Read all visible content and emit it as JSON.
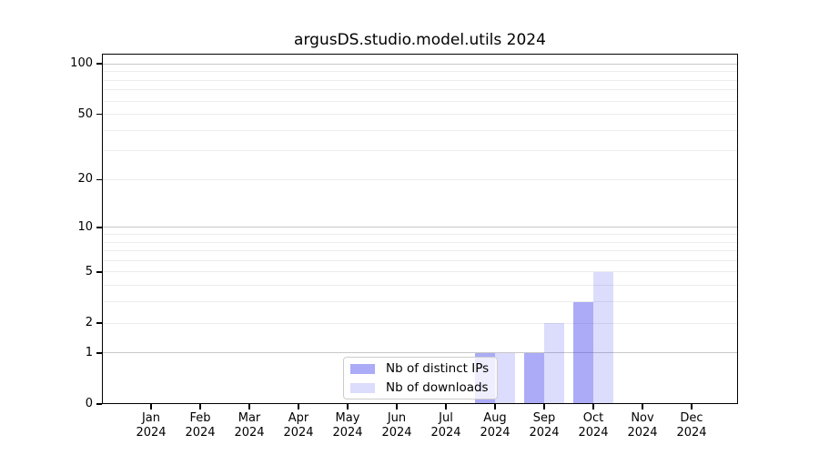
{
  "title": "argusDS.studio.model.utils 2024",
  "chart_data": {
    "type": "bar",
    "title": "argusDS.studio.model.utils 2024",
    "categories": [
      "Jan",
      "Feb",
      "Mar",
      "Apr",
      "May",
      "Jun",
      "Jul",
      "Aug",
      "Sep",
      "Oct",
      "Nov",
      "Dec"
    ],
    "x_year_label": "2024",
    "series": [
      {
        "name": "Nb of distinct IPs",
        "color": "rgba(68,68,238,0.45)",
        "values": [
          0,
          0,
          0,
          0,
          0,
          0,
          0,
          1,
          1,
          3,
          0,
          0
        ]
      },
      {
        "name": "Nb of downloads",
        "color": "rgba(68,68,238,0.19)",
        "values": [
          0,
          0,
          0,
          0,
          0,
          0,
          0,
          1,
          2,
          5,
          0,
          0
        ]
      }
    ],
    "yscale": "log1p",
    "ylim": [
      0,
      115
    ],
    "y_tick_values": [
      0,
      1,
      2,
      5,
      10,
      20,
      50,
      100
    ],
    "major_grid_values": [
      1,
      10,
      100
    ],
    "minor_grid_values": [
      2,
      3,
      4,
      5,
      6,
      7,
      8,
      9,
      20,
      30,
      40,
      50,
      60,
      70,
      80,
      90
    ],
    "grid": true,
    "legend_position": "lower center"
  },
  "colors": {
    "grid_major": "#c8c8c8",
    "grid_minor": "#ececec",
    "axis": "#000000",
    "legend_border": "#cccccc"
  }
}
